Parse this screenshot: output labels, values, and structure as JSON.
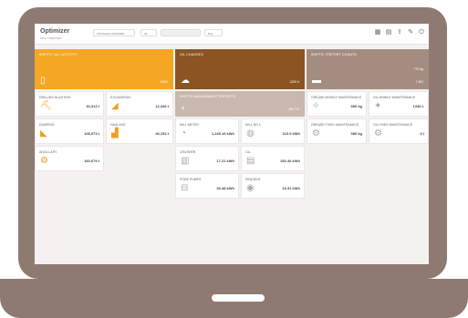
{
  "app": {
    "logo": "Optimizer",
    "breadcrumb": "SITE  OVERVIEW",
    "site_select": "KILNGALE CRUSHER",
    "select2": "All",
    "select3": "",
    "select4": "Day"
  },
  "tiles": {
    "a": {
      "title": "SHIFTS / ALL ACTIVITY",
      "value": "100%"
    },
    "b": {
      "title": "OIL CHANGES",
      "value": "1200 h"
    },
    "c": {
      "title": "SHIFTS / REPORT COUNTS",
      "value": "770 kg",
      "value2": "1 BG"
    },
    "d": {
      "title": "SHIFTS MANAGEMENT REPORTS",
      "value": "400 T/h"
    }
  },
  "cards": [
    {
      "title": "DRILLING BLASTING",
      "value": "30,313 t"
    },
    {
      "title": "EXCAVATION",
      "value": "12,336 t"
    },
    {
      "title": "DUMPING",
      "value": "108,573 t"
    },
    {
      "title": "HAULAGE",
      "value": "40,152 t"
    },
    {
      "title": "ANCILLARY",
      "value": "160,679 t"
    },
    {
      "title": "MILL METER",
      "value": "1,245.16 kWh"
    },
    {
      "title": "MILL NO.1",
      "value": "110.0 kWh"
    },
    {
      "title": "CRUSHER",
      "value": "17.21 kWh"
    },
    {
      "title": "OIL",
      "value": "252.46 kWh"
    },
    {
      "title": "PORE PUMPS",
      "value": "30.48 kWh"
    },
    {
      "title": "REAGENT",
      "value": "16.31 kWh"
    },
    {
      "title": "GREASE MOBILE MAINTENANCE",
      "value": "890 kg"
    },
    {
      "title": "OIL MOBILE MAINTENANCE",
      "value": "1340 L"
    },
    {
      "title": "GREASE FIXED MAINTENANCE",
      "value": "580 kg"
    },
    {
      "title": "OIL FIXED MAINTENANCE",
      "value": "0 l"
    }
  ],
  "colors": {
    "orange": "#f5a623",
    "brown": "#8a5520",
    "taupe": "#a48d80",
    "light_taupe": "#c9b8ae"
  }
}
